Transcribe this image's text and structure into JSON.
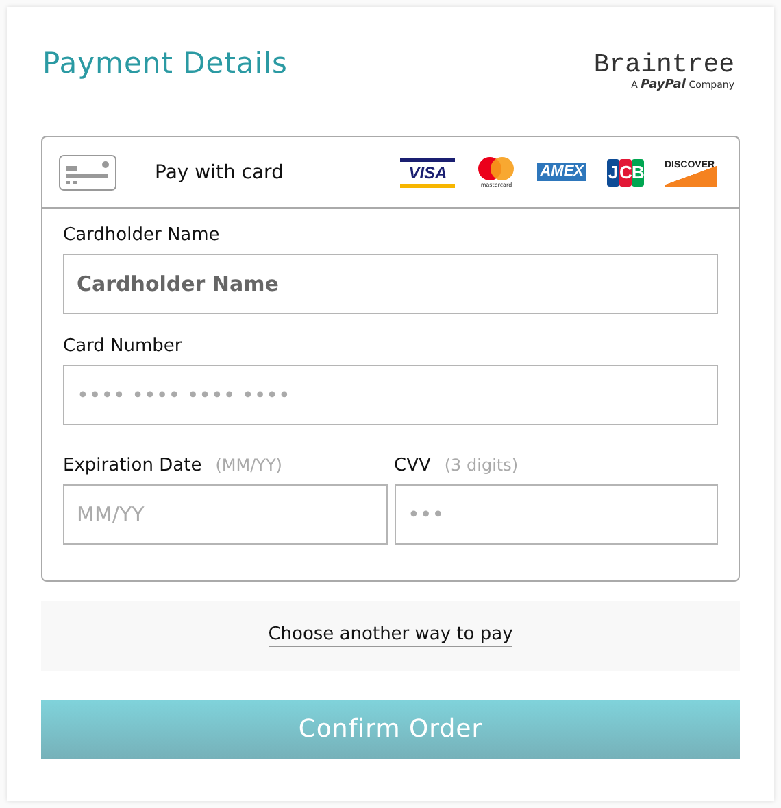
{
  "title": "Payment Details",
  "logo": {
    "name": "Braintree",
    "tagline": "A **PayPal** Company"
  },
  "method": {
    "label": "Pay with card",
    "brands": [
      {
        "kind": "visa",
        "label": "VISA"
      },
      {
        "kind": "mastercard",
        "label": "mastercard"
      },
      {
        "kind": "amex",
        "label": "AMEX"
      },
      {
        "kind": "jcb",
        "label": "JCB"
      },
      {
        "kind": "discover",
        "label": "DISCOVER"
      }
    ]
  },
  "fields": [
    {
      "label": "Cardholder Name",
      "value": "Cardholder Name"
    },
    {
      "label": "Card Number",
      "placeholder": "•••• •••• •••• ••••"
    }
  ],
  "row_fields": [
    {
      "label": "Expiration Date",
      "hint": "(MM/YY)",
      "placeholder": "MM/YY"
    },
    {
      "label": "CVV",
      "hint": "(3 digits)",
      "placeholder": "•••"
    }
  ],
  "other_way_link": "Choose another way to pay",
  "confirm_button": "Confirm Order"
}
